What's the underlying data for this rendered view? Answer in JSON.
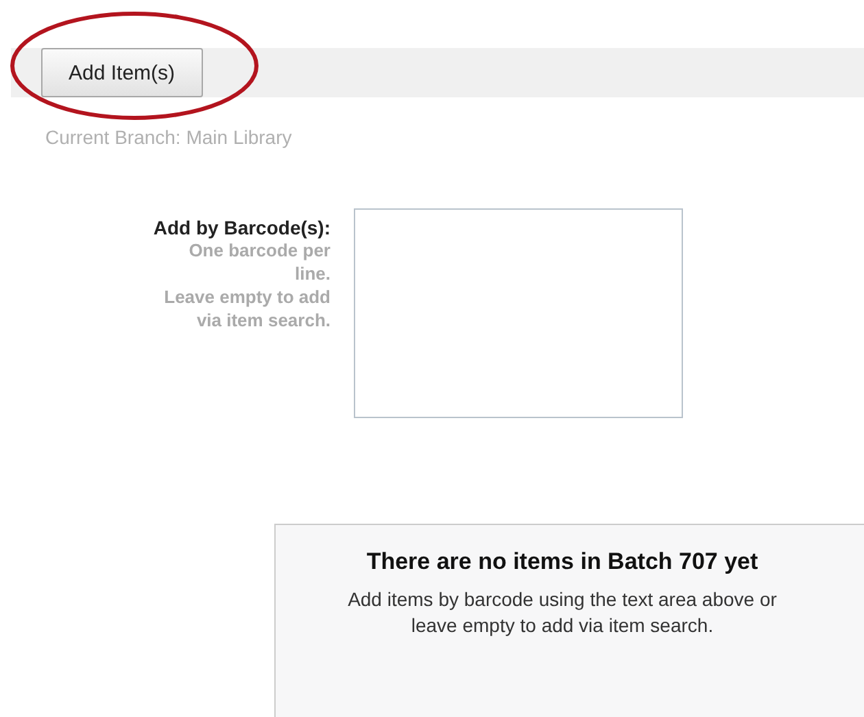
{
  "toolbar": {
    "add_button": "Add Item(s)"
  },
  "current_branch": "Current Branch: Main Library",
  "barcode_form": {
    "label": "Add by Barcode(s):",
    "hints": [
      "One barcode per line.",
      "Leave empty to add via item search."
    ]
  },
  "empty_message": {
    "title": "There are no items in Batch 707 yet",
    "text": "Add items by barcode using the text area above or leave empty to add via item search."
  }
}
